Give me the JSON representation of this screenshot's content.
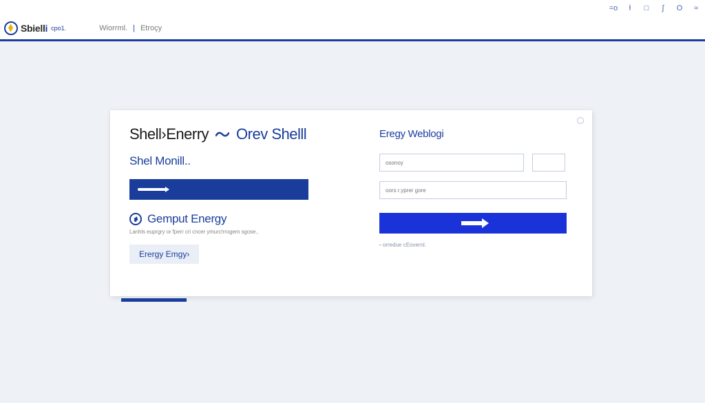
{
  "chrome": {
    "tools": [
      "=o",
      "ƚ",
      "□",
      "ʃ",
      "O",
      "≈"
    ],
    "side_handle": "›"
  },
  "header": {
    "brand_main": "Sbiell",
    "brand_accent": "i",
    "brand_sub": "сро1.",
    "nav_item1": "Wiorrml.",
    "nav_item2": "Etroçy"
  },
  "card": {
    "title_left": "Shell›Enerry",
    "title_right": "Orev Shelll",
    "subtitle": "Shel Monill..",
    "feature_title": "Gemput Energy",
    "feature_desc": "Lanhls euprgry or fperr cri cncer ymurc!rrogem sgose..",
    "chip_label": "Erergy Emgy›"
  },
  "login": {
    "heading": "Eregy Weblogi",
    "field1_placeholder": "osonoy",
    "field2_placeholder": "oors r.yprer gore",
    "helper": "orredue cEovernl."
  }
}
